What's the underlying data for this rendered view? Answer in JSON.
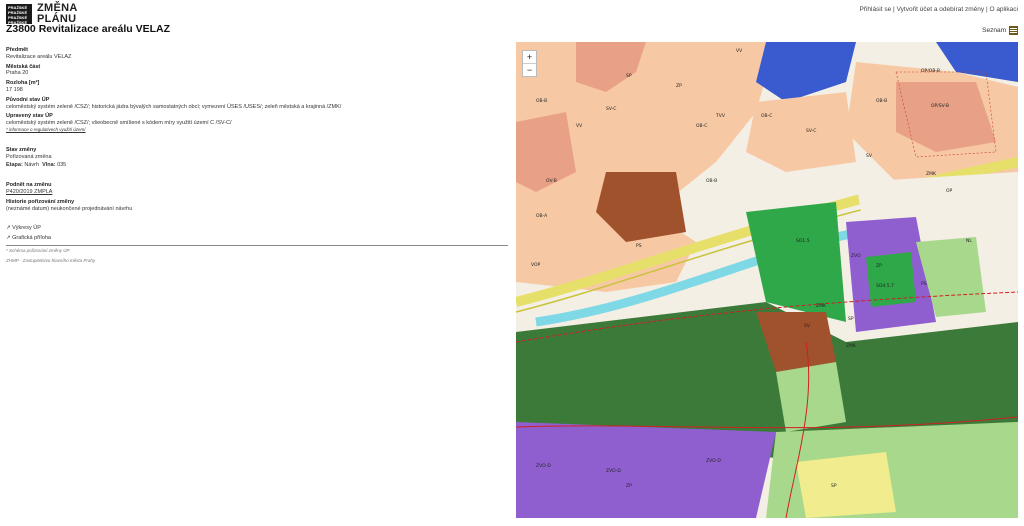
{
  "header": {
    "logo_lines": [
      "PRAŽSKÉ",
      "PRAŽSKÉ",
      "PRAŽSKÉ",
      "PRAŽSKÉ"
    ],
    "brand_line1": "ZMĚNA",
    "brand_line2": "PLÁNU",
    "title": "Z3800 Revitalizace areálu VELAZ"
  },
  "topnav": {
    "login": "Přihlásit se",
    "separator": "|",
    "create": "Vytvořit účet a odebírat změny",
    "about": "O aplikaci"
  },
  "seznam": {
    "label": "Seznam",
    "icon": "menu-icon"
  },
  "details": {
    "predmet_label": "Předmět",
    "predmet_value": "Revitalizace areálu VELAZ",
    "mestska_cast_label": "Městská část",
    "mestska_cast_value": "Praha 20",
    "rozloha_label": "Rozloha [m²]",
    "rozloha_value": "17 198",
    "puvodni_label": "Původní stav ÚP",
    "puvodni_value": "celoměstský systém zeleně /CSZ/; historická jádra bývalých samostatných obcí; vymezení ÚSES /USES/; zeleň městská a krajinná /ZMK/",
    "upraveny_label": "Upravený stav ÚP",
    "upraveny_value": "celoměstský systém zeleně /CSZ/; všeobecně smíšené s kódem míry využití území C /SV-C/",
    "upraveny_note": "* informace o regulativech využití území",
    "stav_label": "Stav změny",
    "stav_value": "Pořizovaná změna",
    "etapa_label": "Etapa:",
    "etapa_value": "Návrh",
    "vlna_label": "Vlna:",
    "vlna_value": "035",
    "podnet_label": "Podnět na změnu",
    "podnet_link": "P420/2019 ZMPLA",
    "historie_label": "Historie pořizování změny",
    "historie_value": "(neznámé datum) neukončené projednávání návrhu",
    "vykresy": "↗ Výkresy ÚP",
    "graficka": "↗ Grafická příloha",
    "footer_note": "* Schéma pořizování změny ÚP",
    "footer_credit": "ZHMP - Zastupitelstvo hlavního města Prahy"
  },
  "map": {
    "zoom_in": "+",
    "zoom_out": "−",
    "labels": [
      "VV",
      "OB-B",
      "OV-B",
      "SP",
      "ZP",
      "VV",
      "OB-B",
      "OB-C",
      "SV-C",
      "OB-B",
      "SV",
      "ZMK",
      "OP",
      "SO1.5",
      "ZVO",
      "ZP",
      "SO4.5.7",
      "PS",
      "SP",
      "SV",
      "ZMK",
      "ZVO-D",
      "ZVO-D",
      "ZVO-D",
      "SP",
      "ZP",
      "VOP",
      "PS",
      "OB-C",
      "OB-A",
      "TVV",
      "ZMK",
      "OP/OB-B",
      "OP/SV-B",
      "SV-C",
      "NL"
    ],
    "colors": {
      "residential": "#f6c9a4",
      "mixed": "#e8a087",
      "green_city": "#2fa84a",
      "green_dark": "#3c7a3a",
      "meadow": "#a8d88c",
      "sport": "#8f5fd0",
      "transport": "#e6e06a",
      "water": "#7fd8e6",
      "public": "#3a5bd0",
      "brown": "#a0522d"
    }
  }
}
